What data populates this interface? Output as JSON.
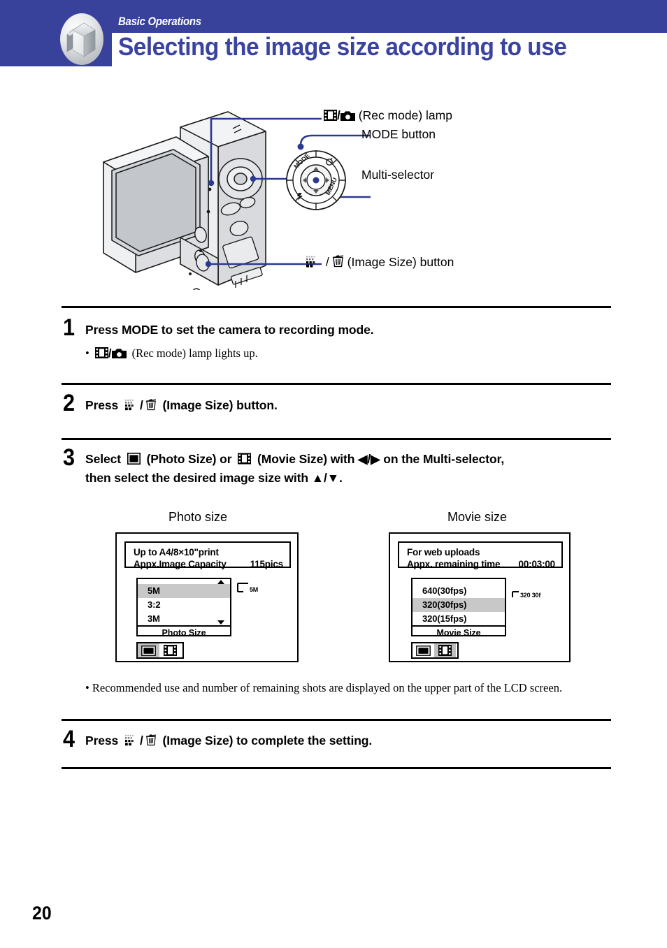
{
  "header": {
    "kicker": "Basic Operations",
    "title": "Selecting the image size according to use",
    "band_color": "#38429b",
    "title_color": "#3b43a0",
    "logo_icon": "cube-logo-icon"
  },
  "diagram": {
    "callouts": [
      {
        "id": "rec-mode-lamp",
        "icons": [
          "movie-icon",
          "camera-icon"
        ],
        "separator": "/",
        "text": "(Rec mode) lamp"
      },
      {
        "id": "mode-button",
        "icons": [],
        "separator": "",
        "text": "MODE button"
      },
      {
        "id": "multi-selector",
        "icons": [],
        "separator": "",
        "text": "Multi-selector"
      },
      {
        "id": "image-size-button",
        "icons": [
          "image-size-grid-icon",
          "trash-icon"
        ],
        "separator": "/",
        "text": "(Image Size) button"
      }
    ],
    "dial_labels": [
      "MODE",
      "self-timer-icon",
      "flash-icon",
      "MENU"
    ],
    "line_color": "#2b3a8f"
  },
  "steps": [
    {
      "number": "1",
      "text": "Press MODE to set the camera to recording mode.",
      "sub": "(Rec mode) lamp lights up.",
      "sub_bullet": "•"
    },
    {
      "number": "2",
      "text_before": "Press",
      "text_after": "(Image Size) button."
    },
    {
      "number": "3",
      "line1_a": "Select",
      "line1_b": "(Photo Size) or",
      "line1_c": "(Movie Size) with ◀/▶ on the Multi-selector,",
      "line2": "then select the desired image size with ▲/▼."
    },
    {
      "number": "4",
      "text_before": "Press",
      "text_after": "(Image Size) to complete the setting."
    }
  ],
  "photo_panel": {
    "caption": "Photo size",
    "info_line1": "Up to A4/8×10\"print",
    "info_label": "Appx.Image Capacity",
    "info_value": "115pics",
    "options": [
      {
        "label": "5M",
        "selected": true
      },
      {
        "label": "3:2",
        "selected": false
      },
      {
        "label": "3M",
        "selected": false
      }
    ],
    "footer": "Photo Size",
    "indicator": "5M",
    "scroll_up": true,
    "scroll_down": true,
    "tabs": [
      {
        "icon": "photo-tab-icon",
        "active": true
      },
      {
        "icon": "movie-tab-icon",
        "active": false
      }
    ]
  },
  "movie_panel": {
    "caption": "Movie size",
    "info_line1": "For web uploads",
    "info_label": "Appx. remaining time",
    "info_value": "00:03:00",
    "options": [
      {
        "label": "640(30fps)",
        "selected": false
      },
      {
        "label": "320(30fps)",
        "selected": true
      },
      {
        "label": "320(15fps)",
        "selected": false
      }
    ],
    "footer": "Movie Size",
    "indicator": "320 30f",
    "scroll_up": false,
    "scroll_down": false,
    "tabs": [
      {
        "icon": "photo-tab-icon",
        "active": false
      },
      {
        "icon": "movie-tab-icon",
        "active": true
      }
    ]
  },
  "note": "• Recommended use and number of remaining shots are displayed on the upper part of the LCD screen.",
  "page_number": "20"
}
